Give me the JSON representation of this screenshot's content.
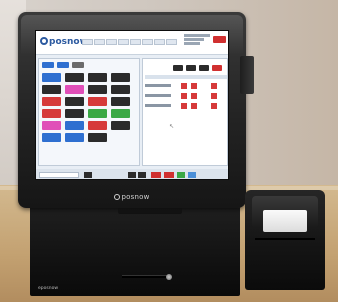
{
  "monitor": {
    "brand_text": "posnow"
  },
  "screen": {
    "brand_text": "posnow"
  },
  "drawer": {
    "brand_text": "eposnow"
  },
  "colors": {
    "screen_accent": "#2c5aa0",
    "exit_button": "#d03030",
    "product_tiles": [
      "#2b2b2b",
      "#2e6fd0",
      "#d63a3a",
      "#3aa845",
      "#e04fb8",
      "#6b6b6b"
    ]
  }
}
